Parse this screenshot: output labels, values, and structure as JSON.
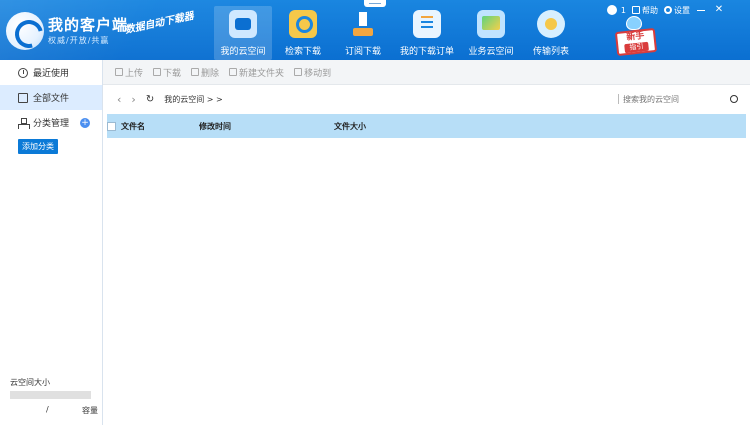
{
  "header": {
    "brand": "我的客户端",
    "tagline": "权威/开放/共赢",
    "slogan": "数据自动下载器",
    "nav": [
      {
        "label": "我的云空间",
        "icon": "cloud-drive-icon"
      },
      {
        "label": "检索下载",
        "icon": "search-download-icon"
      },
      {
        "label": "订阅下载",
        "icon": "subscribe-download-icon"
      },
      {
        "label": "我的下载订单",
        "icon": "download-order-icon"
      },
      {
        "label": "业务云空间",
        "icon": "business-cloud-icon"
      },
      {
        "label": "传输列表",
        "icon": "transfer-list-icon"
      }
    ],
    "user_count": "1",
    "help": "帮助",
    "settings": "设置",
    "newbie_1": "新手",
    "newbie_2": "指引"
  },
  "sidebar": {
    "items": [
      {
        "label": "最近使用",
        "icon": "clock-icon"
      },
      {
        "label": "全部文件",
        "icon": "folder-icon"
      },
      {
        "label": "分类管理",
        "icon": "category-tree-icon"
      }
    ],
    "add_category": "添加分类",
    "storage_title": "云空间大小",
    "storage_slash": "/",
    "storage_capacity": "容量",
    "storage_used_fraction": 0
  },
  "toolbar": {
    "upload": "上传",
    "download": "下载",
    "delete": "删除",
    "new_folder": "新建文件夹",
    "move_to": "移动到"
  },
  "path": {
    "breadcrumb": "我的云空间 > >"
  },
  "search": {
    "placeholder": "搜索我的云空间"
  },
  "table": {
    "columns": [
      "文件名",
      "修改时间",
      "文件大小"
    ]
  },
  "colors": {
    "header_blue": "#0b6fd1",
    "active_bg": "#dcecff",
    "table_header": "#b7def7",
    "add_button": "#0b7ad7"
  }
}
